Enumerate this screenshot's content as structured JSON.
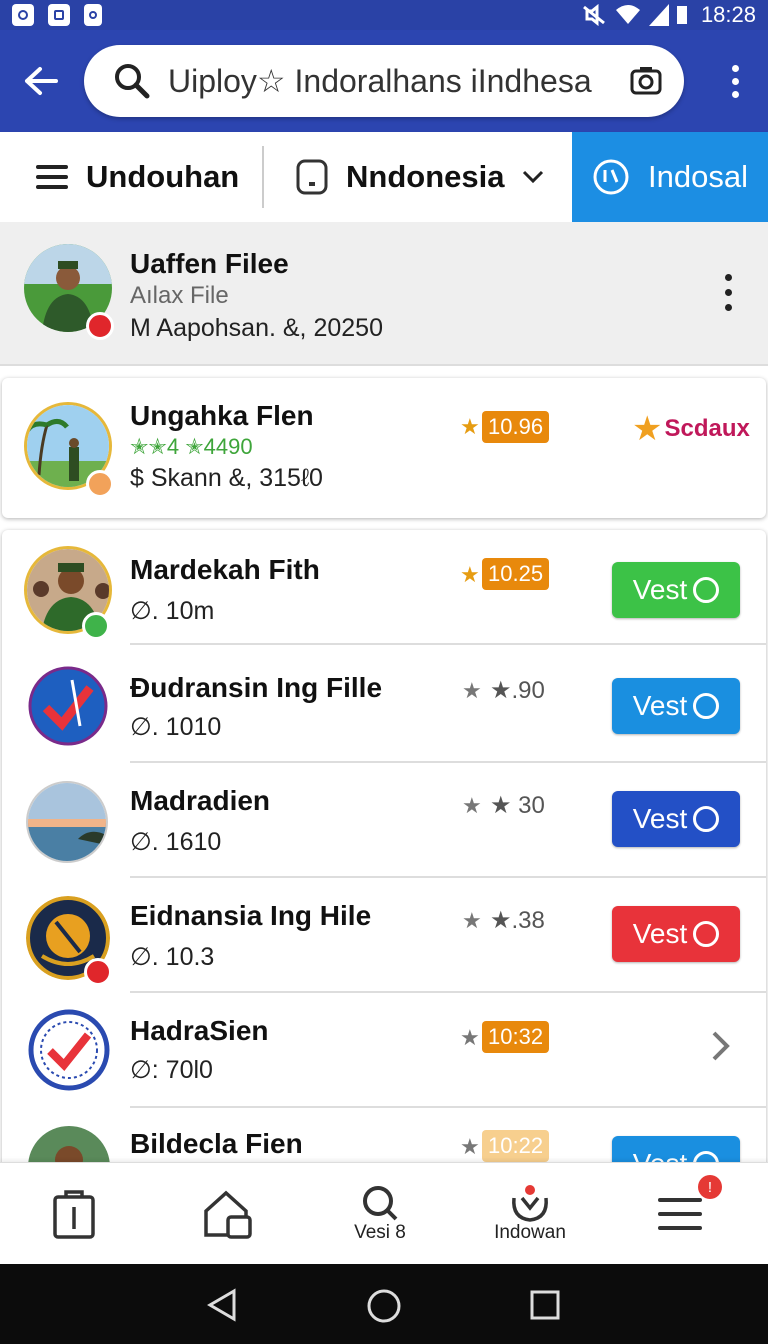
{
  "status_bar": {
    "time": "18:28"
  },
  "search": {
    "value": "Uiploy☆ Indoralhans iIndhesa"
  },
  "tabs": [
    {
      "label": "Undouhan"
    },
    {
      "label": "Nndonesia"
    },
    {
      "label": "Indosal"
    }
  ],
  "header_card": {
    "name": "Uaffen Filee",
    "subtitle": "Aılax File",
    "meta": "M Aapohsan. &, 20250"
  },
  "card2": {
    "name": "Ungahka Flen",
    "stars_text": "✭✭4 ✭4490",
    "meta": "$ Skann &, 315ℓ0",
    "score": "10.96",
    "brand": "Scdaux"
  },
  "list": [
    {
      "name": "Mardekah Fith",
      "meta": "∅. 10m",
      "score": "10.25",
      "score_style": "badge",
      "button": "Vest",
      "button_color": "#3cc247"
    },
    {
      "name": "Ðudransin Ing Fille",
      "meta": "∅. 1010",
      "score": "★.90",
      "score_style": "plain",
      "button": "Vest",
      "button_color": "#1a8fe0"
    },
    {
      "name": "Madradien",
      "meta": "∅. 1610",
      "score": "★ 30",
      "score_style": "plain",
      "button": "Vest",
      "button_color": "#2350c6"
    },
    {
      "name": "Eidnansia Ing Hile",
      "meta": "∅. 10.3",
      "score": "★.38",
      "score_style": "plain",
      "button": "Vest",
      "button_color": "#e8333a"
    },
    {
      "name": "HadraSien",
      "meta": "∅: 70l0",
      "score": "10:32",
      "score_style": "badge",
      "button": "",
      "button_color": ""
    },
    {
      "name": "Bildecla Fien",
      "meta": "",
      "score": "10:22",
      "score_style": "badge-faded",
      "button": "Vest",
      "button_color": "#1a8fe0"
    }
  ],
  "bottom_nav": [
    {
      "label": "",
      "icon": "clipboard-icon"
    },
    {
      "label": "",
      "icon": "home-icon"
    },
    {
      "label": "Vesi 8",
      "icon": "search-icon"
    },
    {
      "label": "Indowan",
      "icon": "notification-icon"
    },
    {
      "label": "",
      "icon": "menu-icon",
      "badge": "!"
    }
  ],
  "colors": {
    "primary": "#2c45b0",
    "accent": "#1c8ee3",
    "score_badge": "#e8890c"
  }
}
